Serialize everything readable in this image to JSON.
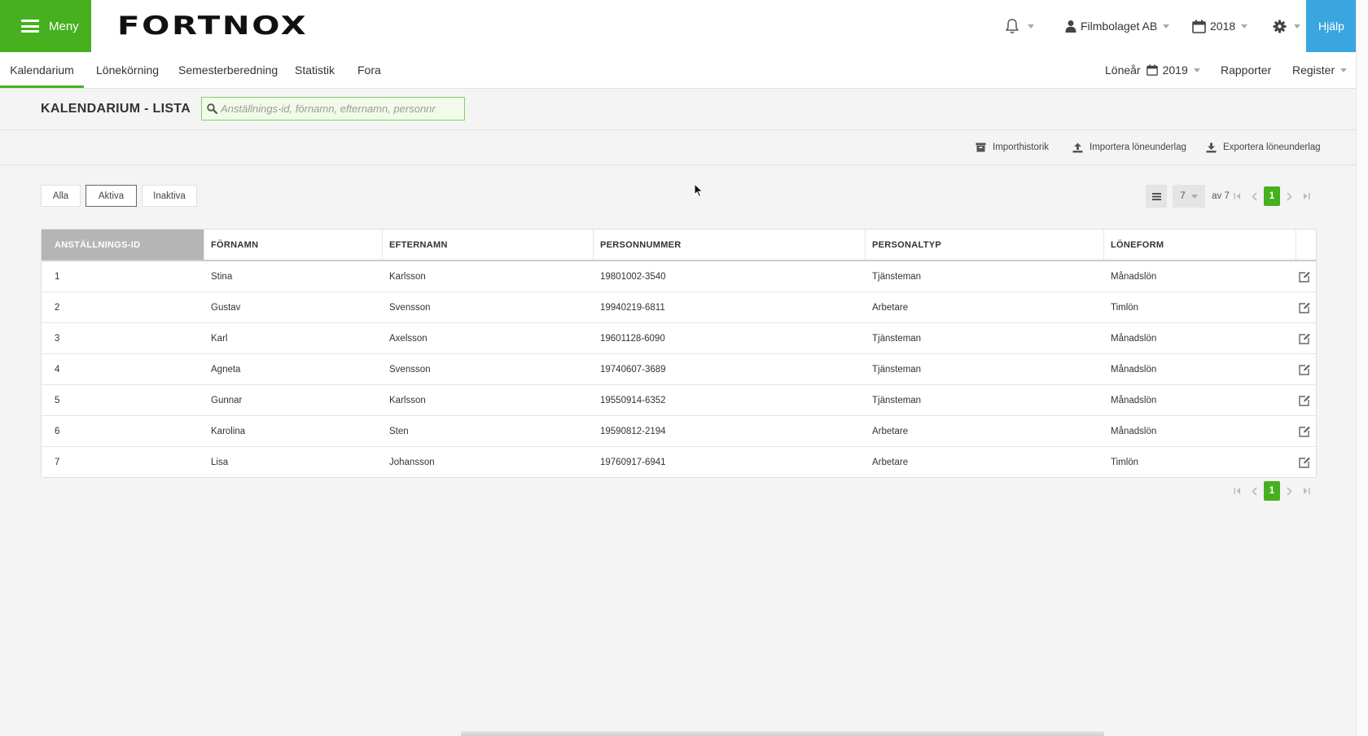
{
  "topbar": {
    "menu_label": "Meny",
    "logo_text": "FORTNOX",
    "company": "Filmbolaget AB",
    "year": "2018",
    "help_label": "Hjälp"
  },
  "nav": {
    "tabs": [
      {
        "label": "Kalendarium",
        "active": true
      },
      {
        "label": "Lönekörning"
      },
      {
        "label": "Semesterberedning"
      },
      {
        "label": "Statistik"
      },
      {
        "label": "Fora"
      }
    ],
    "loneår_label": "Löneår",
    "loneår_value": "2019",
    "reports": "Rapporter",
    "register": "Register"
  },
  "page": {
    "title": "KALENDARIUM - LISTA",
    "search_placeholder": "Anställnings-id, förnamn, efternamn, personnr"
  },
  "actions": {
    "import_history": "Importhistorik",
    "import": "Importera löneunderlag",
    "export": "Exportera löneunderlag"
  },
  "filters": [
    {
      "label": "Alla"
    },
    {
      "label": "Aktiva",
      "active": true
    },
    {
      "label": "Inaktiva"
    }
  ],
  "pagination": {
    "page_size": "7",
    "of_total": "av 7",
    "current_page": "1"
  },
  "table": {
    "headers": [
      "ANSTÄLLNINGS-ID",
      "FÖRNAMN",
      "EFTERNAMN",
      "PERSONNUMMER",
      "PERSONALTYP",
      "LÖNEFORM"
    ],
    "rows": [
      [
        "1",
        "Stina",
        "Karlsson",
        "19801002-3540",
        "Tjänsteman",
        "Månadslön"
      ],
      [
        "2",
        "Gustav",
        "Svensson",
        "19940219-6811",
        "Arbetare",
        "Timlön"
      ],
      [
        "3",
        "Karl",
        "Axelsson",
        "19601128-6090",
        "Tjänsteman",
        "Månadslön"
      ],
      [
        "4",
        "Agneta",
        "Svensson",
        "19740607-3689",
        "Tjänsteman",
        "Månadslön"
      ],
      [
        "5",
        "Gunnar",
        "Karlsson",
        "19550914-6352",
        "Tjänsteman",
        "Månadslön"
      ],
      [
        "6",
        "Karolina",
        "Sten",
        "19590812-2194",
        "Arbetare",
        "Månadslön"
      ],
      [
        "7",
        "Lisa",
        "Johansson",
        "19760917-6941",
        "Arbetare",
        "Timlön"
      ]
    ]
  },
  "colors": {
    "brand_green": "#46b01f",
    "help_blue": "#3aa6e0",
    "sorted_header": "#b5b5b5"
  }
}
